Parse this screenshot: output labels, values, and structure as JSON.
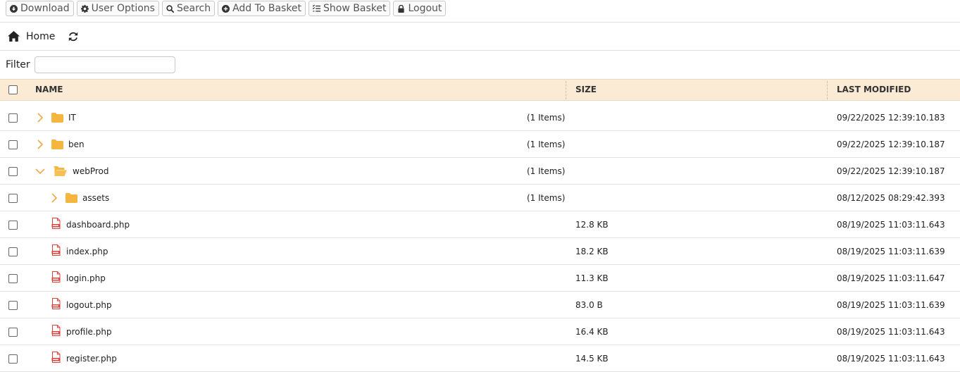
{
  "toolbar": {
    "download": "Download",
    "user_options": "User Options",
    "search": "Search",
    "add_to_basket": "Add To Basket",
    "show_basket": "Show Basket",
    "logout": "Logout"
  },
  "breadcrumb": {
    "home": "Home"
  },
  "filter": {
    "label": "Filter",
    "value": "",
    "placeholder": ""
  },
  "table": {
    "headers": {
      "name": "NAME",
      "size": "SIZE",
      "modified": "LAST MODIFIED"
    },
    "rows": [
      {
        "kind": "folder",
        "name": "IT",
        "expanded": false,
        "level": 0,
        "count": "(1 Items)",
        "size": "",
        "modified": "09/22/2025 12:39:10.183"
      },
      {
        "kind": "folder",
        "name": "ben",
        "expanded": false,
        "level": 0,
        "count": "(1 Items)",
        "size": "",
        "modified": "09/22/2025 12:39:10.187"
      },
      {
        "kind": "folder",
        "name": "webProd",
        "expanded": true,
        "level": 0,
        "count": "(1 Items)",
        "size": "",
        "modified": "09/22/2025 12:39:10.187"
      },
      {
        "kind": "folder",
        "name": "assets",
        "expanded": false,
        "level": 1,
        "count": "(1 Items)",
        "size": "",
        "modified": "08/12/2025 08:29:42.393"
      },
      {
        "kind": "file",
        "name": "dashboard.php",
        "level": 1,
        "count": "",
        "size": "12.8 KB",
        "modified": "08/19/2025 11:03:11.643"
      },
      {
        "kind": "file",
        "name": "index.php",
        "level": 1,
        "count": "",
        "size": "18.2 KB",
        "modified": "08/19/2025 11:03:11.639"
      },
      {
        "kind": "file",
        "name": "login.php",
        "level": 1,
        "count": "",
        "size": "11.3 KB",
        "modified": "08/19/2025 11:03:11.647"
      },
      {
        "kind": "file",
        "name": "logout.php",
        "level": 1,
        "count": "",
        "size": "83.0 B",
        "modified": "08/19/2025 11:03:11.639"
      },
      {
        "kind": "file",
        "name": "profile.php",
        "level": 1,
        "count": "",
        "size": "16.4 KB",
        "modified": "08/19/2025 11:03:11.643"
      },
      {
        "kind": "file",
        "name": "register.php",
        "level": 1,
        "count": "",
        "size": "14.5 KB",
        "modified": "08/19/2025 11:03:11.643"
      }
    ]
  },
  "colors": {
    "header_bg": "#fcebd4",
    "folder": "#f4b63f",
    "file_icon": "#e0403a"
  },
  "icons": {
    "download": "download-circle-icon",
    "user_options": "gear-icon",
    "search": "search-icon",
    "add_to_basket": "plus-circle-icon",
    "show_basket": "list-icon",
    "logout": "lock-icon",
    "home": "home-icon",
    "refresh": "refresh-icon",
    "folder": "folder-icon",
    "file": "php-file-icon"
  }
}
